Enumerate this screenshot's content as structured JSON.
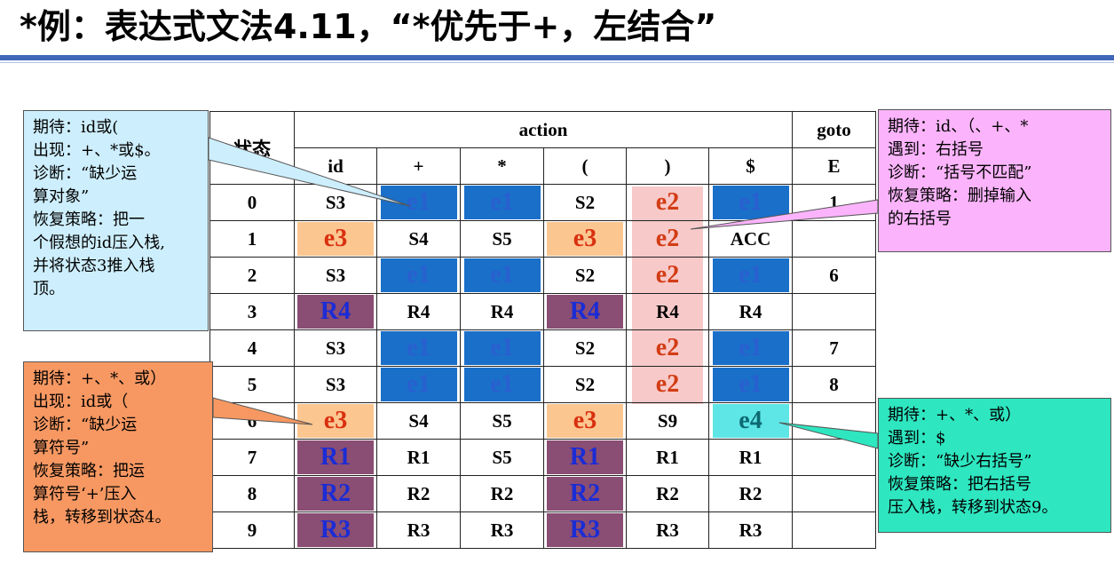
{
  "title": "*例：表达式文法4.11，“*优先于+，左结合”",
  "table": {
    "state_header": "状态",
    "action_header": "action",
    "goto_header": "goto",
    "columns": [
      "id",
      "+",
      "*",
      "(",
      ")",
      "$",
      "E"
    ],
    "rows": [
      {
        "state": "0",
        "cells": [
          "S3",
          "e1",
          "e1",
          "S2",
          "e2",
          "e1",
          "1"
        ]
      },
      {
        "state": "1",
        "cells": [
          "e3",
          "S4",
          "S5",
          "e3",
          "e2",
          "ACC",
          ""
        ]
      },
      {
        "state": "2",
        "cells": [
          "S3",
          "e1",
          "e1",
          "S2",
          "e2",
          "e1",
          "6"
        ]
      },
      {
        "state": "3",
        "cells": [
          "R4",
          "R4",
          "R4",
          "R4",
          "R4",
          "R4",
          ""
        ]
      },
      {
        "state": "4",
        "cells": [
          "S3",
          "e1",
          "e1",
          "S2",
          "e2",
          "e1",
          "7"
        ]
      },
      {
        "state": "5",
        "cells": [
          "S3",
          "e1",
          "e1",
          "S2",
          "e2",
          "e1",
          "8"
        ]
      },
      {
        "state": "6",
        "cells": [
          "e3",
          "S4",
          "S5",
          "e3",
          "S9",
          "e4",
          ""
        ]
      },
      {
        "state": "7",
        "cells": [
          "R1",
          "R1",
          "S5",
          "R1",
          "R1",
          "R1",
          ""
        ]
      },
      {
        "state": "8",
        "cells": [
          "R2",
          "R2",
          "R2",
          "R2",
          "R2",
          "R2",
          ""
        ]
      },
      {
        "state": "9",
        "cells": [
          "R3",
          "R3",
          "R3",
          "R3",
          "R3",
          "R3",
          ""
        ]
      }
    ]
  },
  "notes": {
    "e1": "期待：id或(\n出现：+、*或$。\n诊断：“缺少运\n算对象”\n恢复策略：把一\n个假想的id压入栈,\n并将状态3推入栈\n顶。",
    "e2": "期待：id、（、+、*\n遇到：右括号\n诊断：“括号不匹配”\n恢复策略：删掉输入\n的右括号",
    "e3": "期待：+、*、或）\n出现：id或（\n诊断：“缺少运\n算符号”\n恢复策略：把运\n算符号‘+’压入\n栈，转移到状态4。",
    "e4": "期待：+、*、或）\n遇到：$\n诊断：“缺少右括号”\n恢复策略：把右括号\n压入栈，转移到状态9。"
  },
  "colors": {
    "e1": "#1a6fc9",
    "e2": "#f8c9c9",
    "e3": "#fcc691",
    "e4": "#5ee6e6",
    "reduce": "#8a4d73",
    "title_rule": "#3f66b8"
  }
}
